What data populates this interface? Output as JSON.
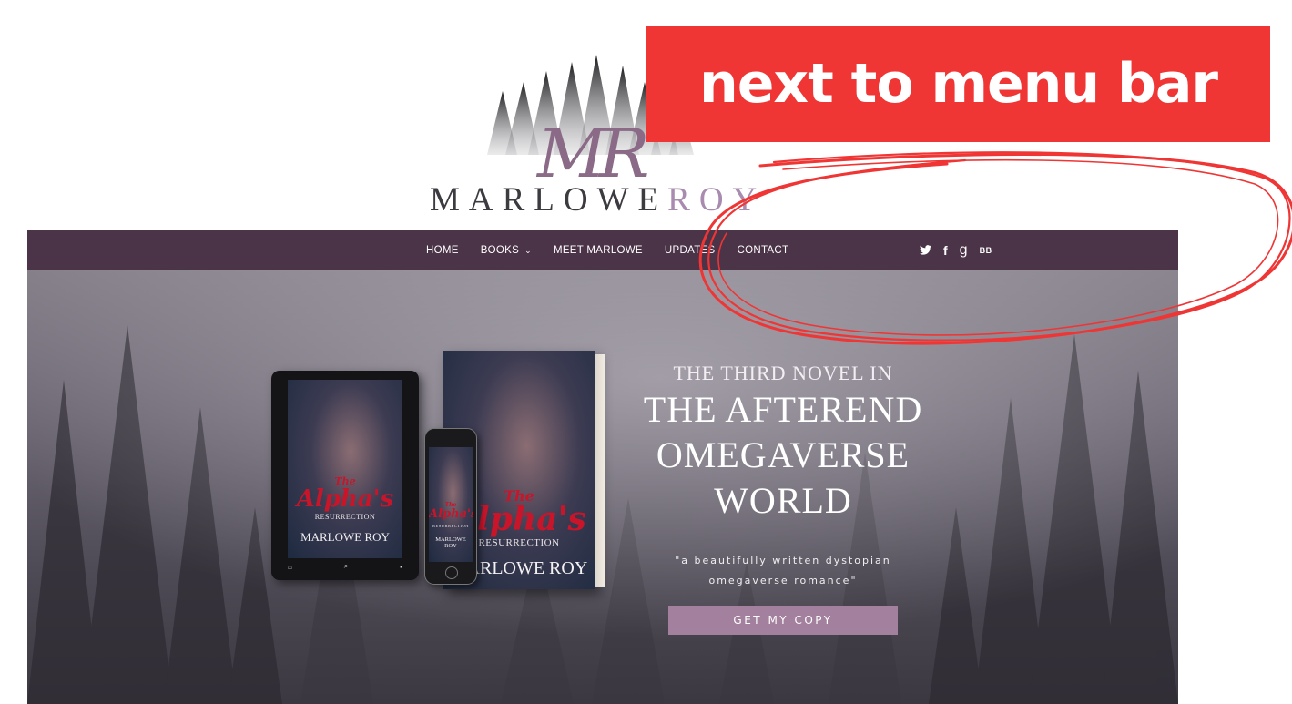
{
  "logo": {
    "monogram": "MR",
    "wordmark_main": "MARLOWE",
    "wordmark_tail": "ROY"
  },
  "annotation": {
    "label": "next to menu bar",
    "color": "#f03535"
  },
  "nav": {
    "items": [
      {
        "label": "HOME"
      },
      {
        "label": "BOOKS"
      },
      {
        "label": "MEET MARLOWE"
      },
      {
        "label": "UPDATES"
      },
      {
        "label": "CONTACT"
      }
    ],
    "social": [
      {
        "icon": "twitter-icon",
        "glyph": "🐦"
      },
      {
        "icon": "facebook-icon",
        "glyph": "f"
      },
      {
        "icon": "goodreads-icon",
        "glyph": "g"
      },
      {
        "icon": "bookbub-icon",
        "glyph": "BB"
      }
    ],
    "bg_color": "#4b3348"
  },
  "hero": {
    "eyebrow": "THE THIRD NOVEL IN",
    "title_lines": [
      "THE AFTEREND",
      "OMEGAVERSE",
      "WORLD"
    ],
    "quote": "\"a beautifully written dystopian omegaverse romance\"",
    "cta_label": "GET MY COPY",
    "cta_color": "#a3809d"
  },
  "book_cover": {
    "title_line1": "The",
    "title_line2": "Alpha's",
    "subtitle": "RESURRECTION",
    "author": "MARLOWE ROY"
  }
}
